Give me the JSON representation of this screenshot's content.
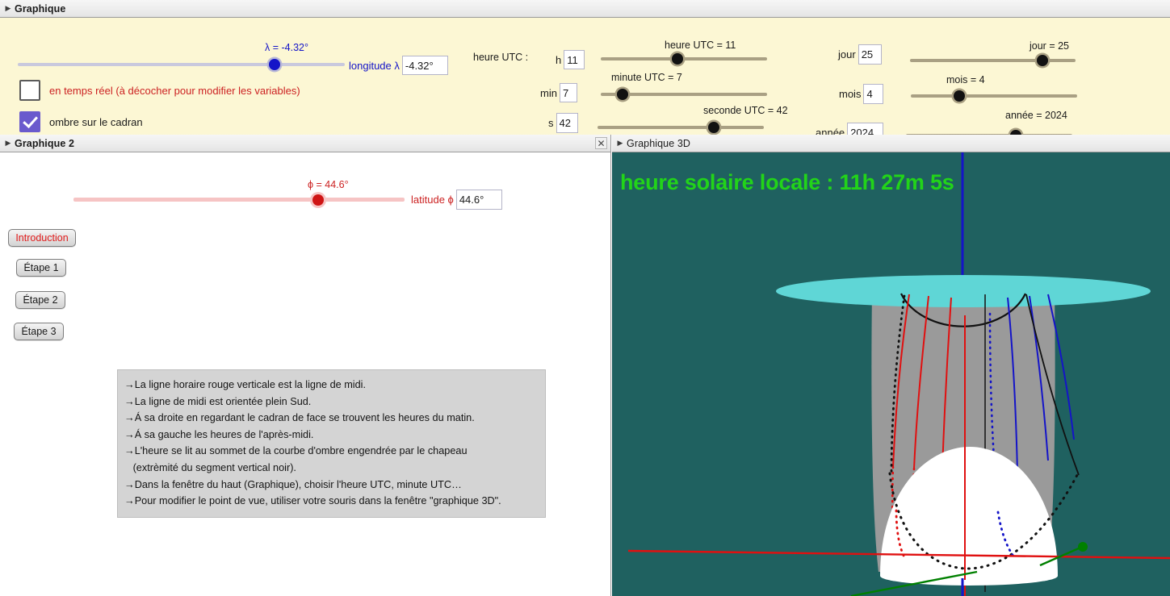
{
  "panels": {
    "graph1": {
      "title": "Graphique"
    },
    "graph2": {
      "title": "Graphique 2",
      "close_label": "✕"
    },
    "graph3d": {
      "title": "Graphique 3D"
    }
  },
  "colors": {
    "panel_bg": "#fcf7d4",
    "blue": "#1414c8",
    "red": "#cc2222",
    "checkbox_checked": "#6a5acd",
    "slider_tan": "#a9a083",
    "scene_bg": "#1f6160",
    "disk_cyan": "#5fd6d6",
    "solar_text": "#22d419",
    "instructions_bg": "#d4d4d4"
  },
  "top": {
    "longitude_slider": {
      "label": "λ = -4.32°",
      "value": -4.32,
      "min": -180,
      "max": 180,
      "pos_pct": 78.5
    },
    "longitude_field": {
      "label": "longitude λ",
      "value": "-4.32°"
    },
    "checkbox_realtime": {
      "label": "en temps réel (à décocher pour modifier les variables)",
      "checked": false
    },
    "checkbox_shadow": {
      "label": "ombre sur le cadran",
      "checked": true
    },
    "time_group_label": "heure UTC :",
    "fields": [
      {
        "name": "heure",
        "label": "h",
        "value": "11"
      },
      {
        "name": "minute",
        "label": "min",
        "value": "7"
      },
      {
        "name": "seconde",
        "label": "s",
        "value": "42"
      }
    ],
    "time_sliders": [
      {
        "label": "heure UTC = 11",
        "value": 11,
        "min": 0,
        "max": 23,
        "pos_pct": 46
      },
      {
        "label": "minute UTC = 7",
        "value": 7,
        "min": 0,
        "max": 59,
        "pos_pct": 13
      },
      {
        "label": "seconde UTC = 42",
        "value": 42,
        "min": 0,
        "max": 59,
        "pos_pct": 70
      }
    ],
    "date_fields": [
      {
        "name": "jour",
        "label": "jour",
        "value": "25"
      },
      {
        "name": "mois",
        "label": "mois",
        "value": "4"
      },
      {
        "name": "annee",
        "label": "année",
        "value": "2024"
      }
    ],
    "date_sliders": [
      {
        "label": "jour = 25",
        "value": 25,
        "min": 1,
        "max": 31,
        "pos_pct": 80
      },
      {
        "label": "mois = 4",
        "value": 4,
        "min": 1,
        "max": 12,
        "pos_pct": 29
      },
      {
        "label": "année = 2024",
        "value": 2024,
        "min": 2000,
        "max": 2050,
        "pos_pct": 66
      }
    ]
  },
  "graph2": {
    "latitude_slider": {
      "label": "ϕ = 44.6°",
      "value": 44.6,
      "min": -90,
      "max": 90,
      "pos_pct": 74
    },
    "latitude_field": {
      "label": "latitude ϕ",
      "value": "44.6°"
    },
    "buttons": [
      {
        "id": "introduction",
        "label": "Introduction",
        "accent": true
      },
      {
        "id": "etape1",
        "label": "Étape 1",
        "accent": false
      },
      {
        "id": "etape2",
        "label": "Étape 2",
        "accent": false
      },
      {
        "id": "etape3",
        "label": "Étape 3",
        "accent": false
      }
    ],
    "instructions": [
      "→La ligne horaire rouge verticale est la ligne de midi.",
      "→La ligne de midi est orientée plein Sud.",
      "→Á sa droite en regardant le cadran de face se trouvent les heures du matin.",
      "→Á sa gauche les heures de l'après-midi.",
      "→L'heure se lit au sommet de la courbe d'ombre engendrée par le chapeau",
      "   (extrèmité du segment vertical noir).",
      "→Dans la fenêtre du haut (Graphique), choisir l'heure UTC, minute UTC…",
      "→Pour modifier le point de vue, utiliser votre souris dans la fenêtre \"graphique 3D\"."
    ]
  },
  "graph3d": {
    "solar_time_text": "heure solaire locale : 11h 27m 5s",
    "axes": [
      {
        "name": "x-axis",
        "color": "#e01010"
      },
      {
        "name": "y-axis",
        "color": "#008000"
      },
      {
        "name": "z-axis",
        "color": "#1414c8"
      }
    ],
    "objects": [
      {
        "name": "horizontal-disk",
        "color": "#5fd6d6"
      },
      {
        "name": "cylinder-dial",
        "color": "#9a9a9a"
      },
      {
        "name": "white-dome",
        "color": "#ffffff"
      },
      {
        "name": "noon-line",
        "color": "#e01010"
      },
      {
        "name": "morning-hour-lines",
        "color": "#e01010"
      },
      {
        "name": "afternoon-hour-lines",
        "color": "#1414c8"
      },
      {
        "name": "shadow-curve",
        "color": "#000000"
      }
    ]
  }
}
